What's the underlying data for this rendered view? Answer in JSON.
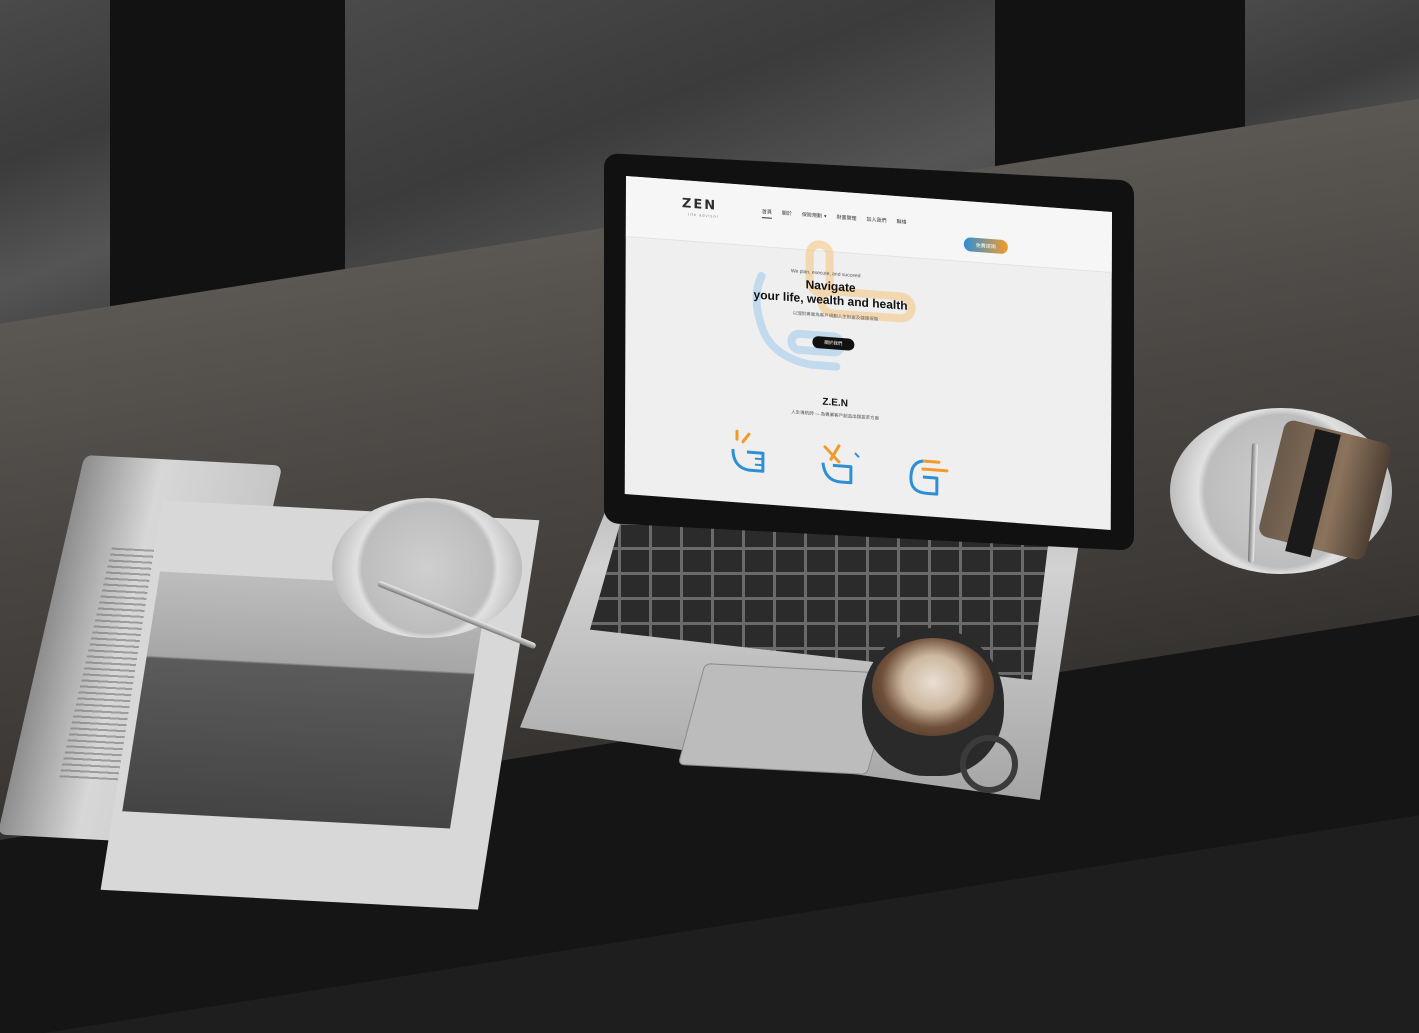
{
  "site": {
    "logo_text": "ZEN",
    "logo_subtitle": "life advisor",
    "nav": {
      "items": [
        {
          "label": "首頁",
          "active": true
        },
        {
          "label": "關於",
          "active": false
        },
        {
          "label": "保險規劃",
          "active": false,
          "has_dropdown": true
        },
        {
          "label": "財富管理",
          "active": false
        },
        {
          "label": "加入我們",
          "active": false
        },
        {
          "label": "聯絡",
          "active": false
        }
      ],
      "cta_label": "免費諮詢"
    },
    "hero": {
      "tagline": "We plan, execute, and succeed",
      "title_line1": "Navigate",
      "title_line2": "your life, wealth and health",
      "subtitle": "以理財專業為客戶規劃人生財富及健康保障",
      "button_label": "關於我們"
    },
    "section": {
      "title": "Z.E.N",
      "subtitle": "人生導航師 — 為專業客戶創造出類拔萃方案"
    },
    "colors": {
      "accent_blue": "#2d8fd5",
      "accent_orange": "#f29b2a",
      "text_dark": "#111111",
      "background": "#efefef"
    },
    "icons": [
      "hand-thumbs-up-icon",
      "hand-cross-fingers-icon",
      "hand-pointing-icon"
    ]
  }
}
